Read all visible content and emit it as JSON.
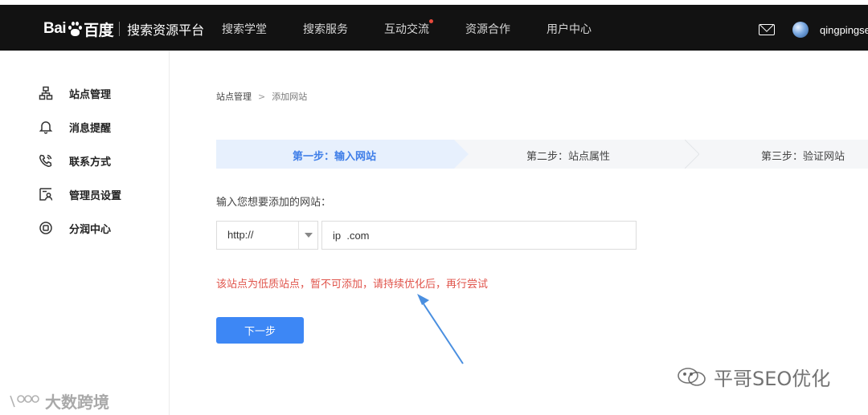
{
  "header": {
    "logo_text_left": "Bai",
    "logo_text_right": "百度",
    "platform": "搜索资源平台",
    "nav": [
      {
        "label": "搜索学堂",
        "dot": false
      },
      {
        "label": "搜索服务",
        "dot": false
      },
      {
        "label": "互动交流",
        "dot": true
      },
      {
        "label": "资源合作",
        "dot": false
      },
      {
        "label": "用户中心",
        "dot": false
      }
    ],
    "username": "qingpingse",
    "mail_icon": "mail-icon",
    "avatar_icon": "avatar"
  },
  "sidebar": {
    "items": [
      {
        "label": "站点管理",
        "icon": "sitemap-icon"
      },
      {
        "label": "消息提醒",
        "icon": "bell-icon"
      },
      {
        "label": "联系方式",
        "icon": "phone-icon"
      },
      {
        "label": "管理员设置",
        "icon": "admin-icon"
      },
      {
        "label": "分润中心",
        "icon": "coin-icon"
      }
    ]
  },
  "breadcrumb": {
    "root": "站点管理",
    "separator": ">",
    "current": "添加网站"
  },
  "steps": [
    {
      "label": "第一步：输入网站",
      "active": true
    },
    {
      "label": "第二步：站点属性",
      "active": false
    },
    {
      "label": "第三步：验证网站",
      "active": false
    }
  ],
  "form": {
    "prompt": "输入您想要添加的网站：",
    "protocol": "http://",
    "url_value": "ip  .com",
    "error": "该站点为低质站点，暂不可添加，请持续优化后，再行尝试",
    "next_button": "下一步"
  },
  "watermarks": {
    "right": "平哥SEO优化",
    "left": "大数跨境"
  },
  "colors": {
    "topbar": "#121212",
    "accent": "#3d87f5",
    "active_step_bg": "#e7f0fd",
    "active_step_text": "#3f7ee8",
    "error": "#e0544b",
    "arrow": "#4a8fe0"
  }
}
